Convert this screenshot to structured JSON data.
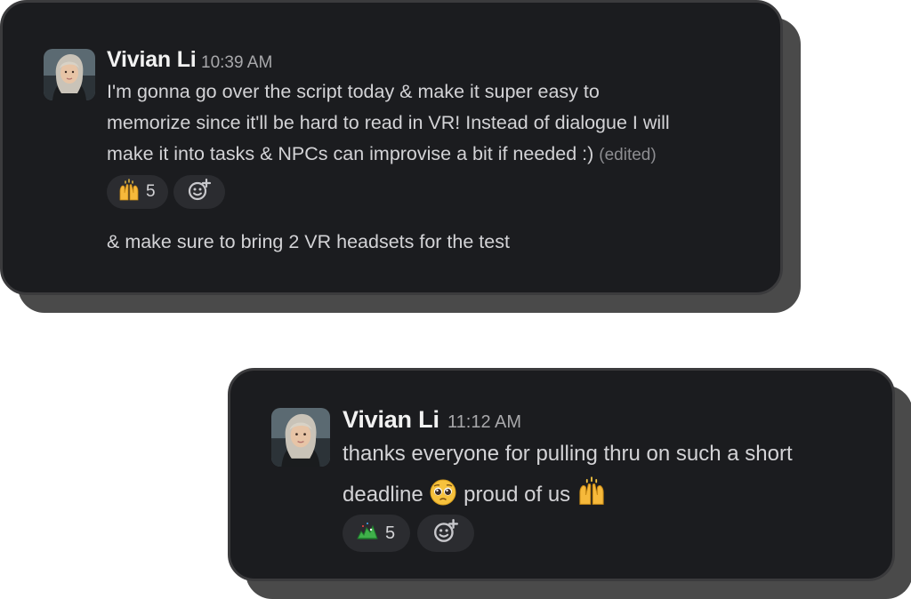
{
  "messages": [
    {
      "author": "Vivian Li",
      "time": "10:39 AM",
      "lines": [
        "I'm gonna go over the script today & make it super easy to",
        "memorize since it'll be hard to read in VR! Instead of dialogue I will",
        "make it into tasks & NPCs can improvise a bit if needed :)"
      ],
      "edited_label": "(edited)",
      "reaction": {
        "emoji_icon": "raised-hands-icon",
        "count": "5"
      },
      "add_reaction_icon": "add-emoji-icon",
      "followup": "& make sure to bring 2 VR headsets for the test"
    },
    {
      "author": "Vivian Li",
      "time": "11:12 AM",
      "line1": "thanks everyone for pulling thru on such a short",
      "line2_a": "deadline",
      "line2_b": "proud of us",
      "inline_emojis": [
        "pleading-face-icon",
        "raised-hands-icon"
      ],
      "reaction": {
        "emoji_icon": "party-dragon-icon",
        "count": "5"
      },
      "add_reaction_icon": "add-emoji-icon"
    }
  ],
  "colors": {
    "card_bg": "#1b1c1f",
    "card_border": "#3b3b3d",
    "shadow": "#4a4a4a",
    "text": "#d3d3d6",
    "name": "#f2f2f2",
    "muted": "#a8a8ab",
    "chip_bg": "#2b2c30"
  }
}
